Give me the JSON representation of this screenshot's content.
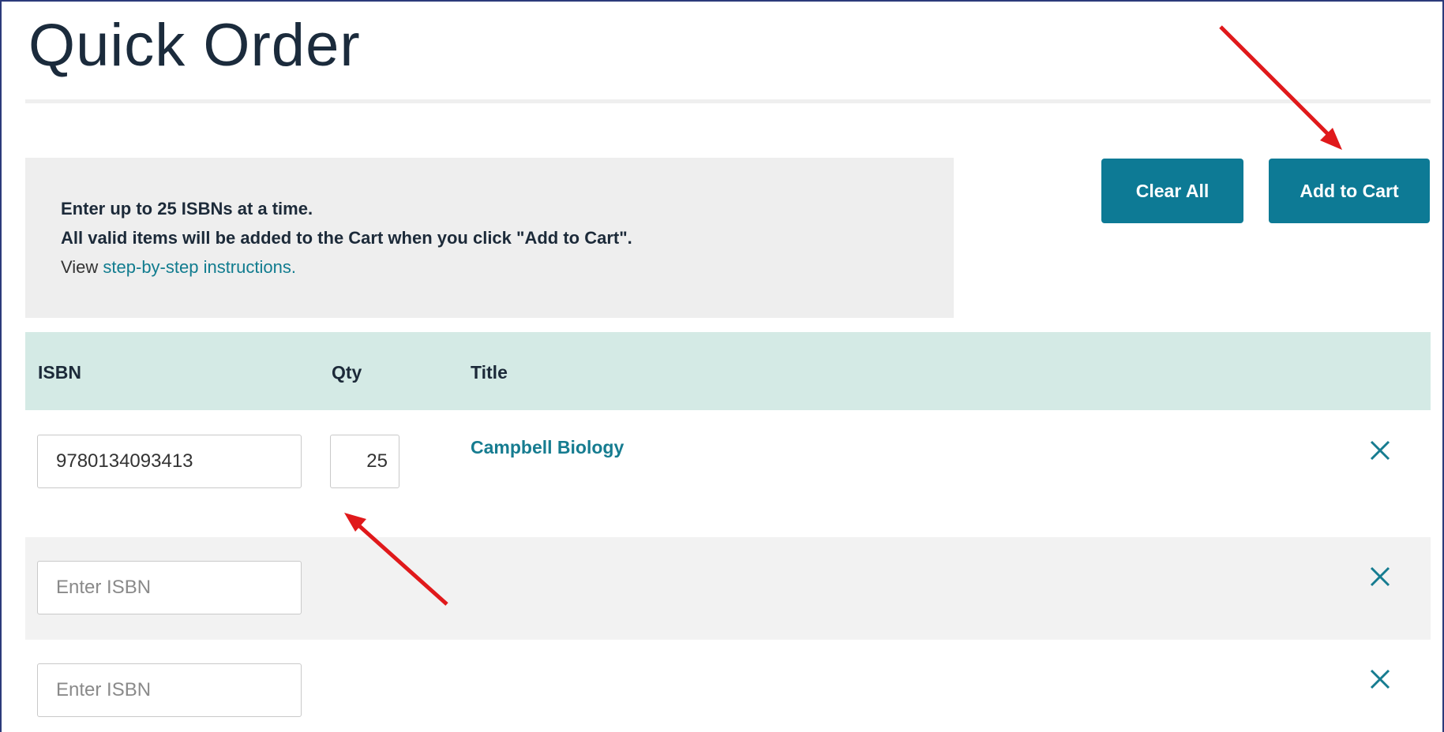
{
  "page": {
    "title": "Quick Order"
  },
  "info": {
    "line1": "Enter up to 25 ISBNs at a time.",
    "line2": "All valid items will be added to the Cart when you click \"Add to Cart\".",
    "line3_prefix": "View ",
    "line3_link": "step-by-step instructions."
  },
  "buttons": {
    "clear_all": "Clear All",
    "add_to_cart": "Add to Cart"
  },
  "table": {
    "headers": {
      "isbn": "ISBN",
      "qty": "Qty",
      "title": "Title"
    },
    "rows": [
      {
        "isbn": "9780134093413",
        "qty": "25",
        "title": "Campbell Biology",
        "placeholder": "Enter ISBN"
      },
      {
        "isbn": "",
        "qty": "",
        "title": "",
        "placeholder": "Enter ISBN"
      },
      {
        "isbn": "",
        "qty": "",
        "title": "",
        "placeholder": "Enter ISBN"
      }
    ]
  },
  "colors": {
    "accent": "#0d7a95",
    "header_bg": "#d4eae5",
    "link": "#167c90",
    "annotation_arrow": "#e0191b"
  },
  "icons": {
    "remove": "close-icon"
  }
}
